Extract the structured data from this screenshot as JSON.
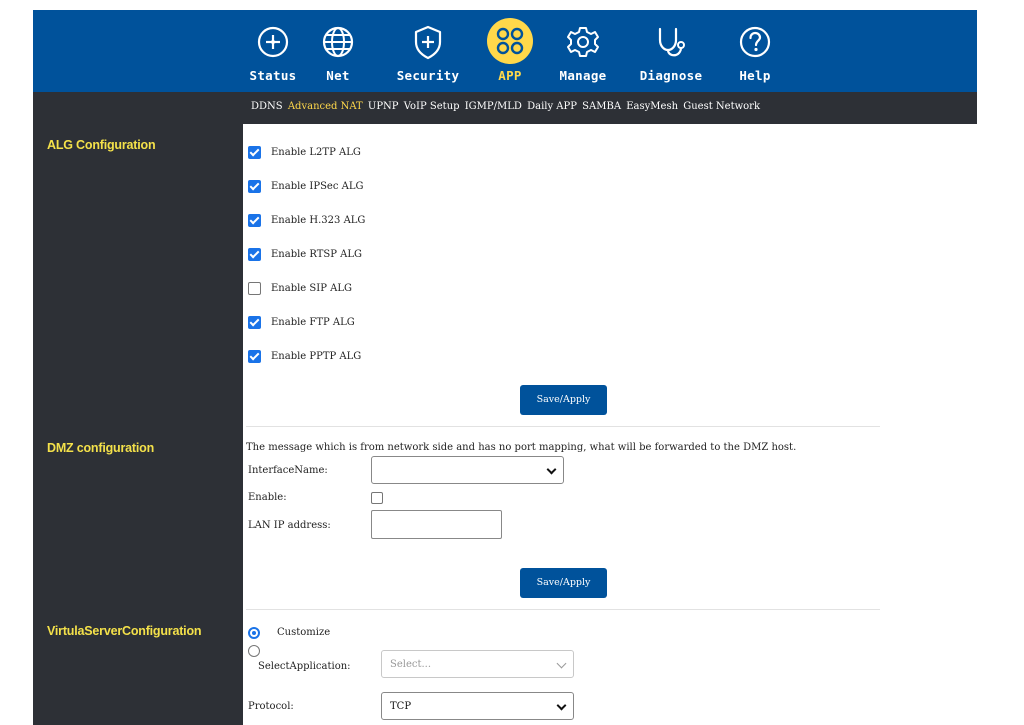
{
  "nav": {
    "items": [
      {
        "label": "Status",
        "icon": "crosshair-icon"
      },
      {
        "label": "Net",
        "icon": "globe-icon"
      },
      {
        "label": "Security",
        "icon": "shield-plus-icon"
      },
      {
        "label": "APP",
        "icon": "apps-icon",
        "active": true
      },
      {
        "label": "Manage",
        "icon": "gear-icon"
      },
      {
        "label": "Diagnose",
        "icon": "stethoscope-icon"
      },
      {
        "label": "Help",
        "icon": "help-circle-icon"
      }
    ]
  },
  "subnav": {
    "items": [
      "DDNS",
      "Advanced NAT",
      "UPNP",
      "VoIP Setup",
      "IGMP/MLD",
      "Daily APP",
      "SAMBA",
      "EasyMesh",
      "Guest Network"
    ],
    "active": "Advanced NAT"
  },
  "sidebar": {
    "sections": [
      "ALG Configuration",
      "DMZ configuration",
      "VirtulaServerConfiguration"
    ]
  },
  "alg": {
    "options": [
      {
        "label": "Enable L2TP ALG",
        "checked": true
      },
      {
        "label": "Enable IPSec ALG",
        "checked": true
      },
      {
        "label": "Enable H.323 ALG",
        "checked": true
      },
      {
        "label": "Enable RTSP ALG",
        "checked": true
      },
      {
        "label": "Enable SIP ALG",
        "checked": false
      },
      {
        "label": "Enable FTP ALG",
        "checked": true
      },
      {
        "label": "Enable PPTP ALG",
        "checked": true
      }
    ],
    "save_label": "Save/Apply"
  },
  "dmz": {
    "message": "The message which is from network side and has no port mapping, what will be forwarded to the DMZ host.",
    "interface_label": "InterfaceName:",
    "interface_value": "",
    "enable_label": "Enable:",
    "enable_checked": false,
    "lan_ip_label": "LAN IP address:",
    "lan_ip_value": "",
    "save_label": "Save/Apply"
  },
  "virtual_server": {
    "customize_label": "Customize",
    "customize_selected": true,
    "select_app_label": "SelectApplication:",
    "select_app_placeholder": "Select...",
    "protocol_label": "Protocol:",
    "protocol_value": "TCP"
  },
  "colors": {
    "nav_bg": "#00529b",
    "sidebar_bg": "#2d3036",
    "accent_yellow": "#ffd84a",
    "checkbox_blue": "#1a73e8"
  }
}
